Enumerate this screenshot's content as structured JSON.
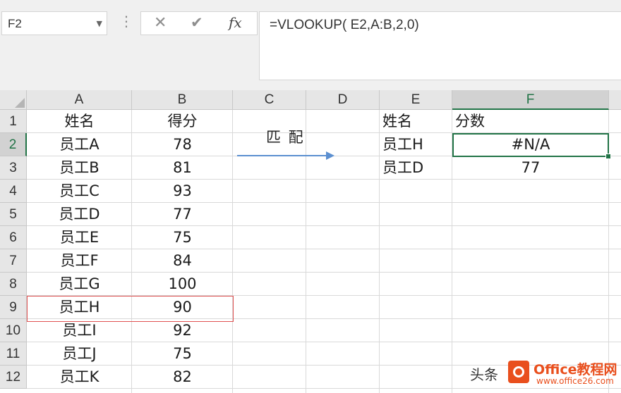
{
  "name_box": {
    "value": "F2"
  },
  "toolbar": {
    "cancel_icon": "close-icon",
    "enter_icon": "check-icon",
    "fx_label": "fx"
  },
  "formula_bar": {
    "value": "=VLOOKUP( E2,A:B,2,0)"
  },
  "columns": [
    "A",
    "B",
    "C",
    "D",
    "E",
    "F"
  ],
  "selected_column": "F",
  "rows": [
    "1",
    "2",
    "3",
    "4",
    "5",
    "6",
    "7",
    "8",
    "9",
    "10",
    "11",
    "12"
  ],
  "selected_row": "2",
  "cells": {
    "A1": "姓名",
    "B1": "得分",
    "A2": "员工A",
    "B2": "78",
    "A3": "员工B",
    "B3": "81",
    "A4": "员工C",
    "B4": "93",
    "A5": "员工D",
    "B5": "77",
    "A6": "员工E",
    "B6": "75",
    "A7": "员工F",
    "B7": "84",
    "A8": "员工G",
    "B8": "100",
    "A9": "员工H",
    "B9": "90",
    "A10": "员工I",
    "B10": "92",
    "A11": "员工J",
    "B11": "75",
    "A12": "员工K",
    "B12": "82",
    "E1": "姓名",
    "F1": "分数",
    "E2": "员工H",
    "F2": "#N/A",
    "E3": "员工D",
    "F3": "77"
  },
  "annotation": {
    "label": "匹 配"
  },
  "watermark": {
    "prefix": "头条",
    "brand": "Office教程网",
    "url": "www.office26.com"
  },
  "colors": {
    "accent_green": "#217346",
    "highlight_red": "#e05252",
    "arrow_blue": "#5b8fd0",
    "brand_orange": "#e94f1d"
  }
}
